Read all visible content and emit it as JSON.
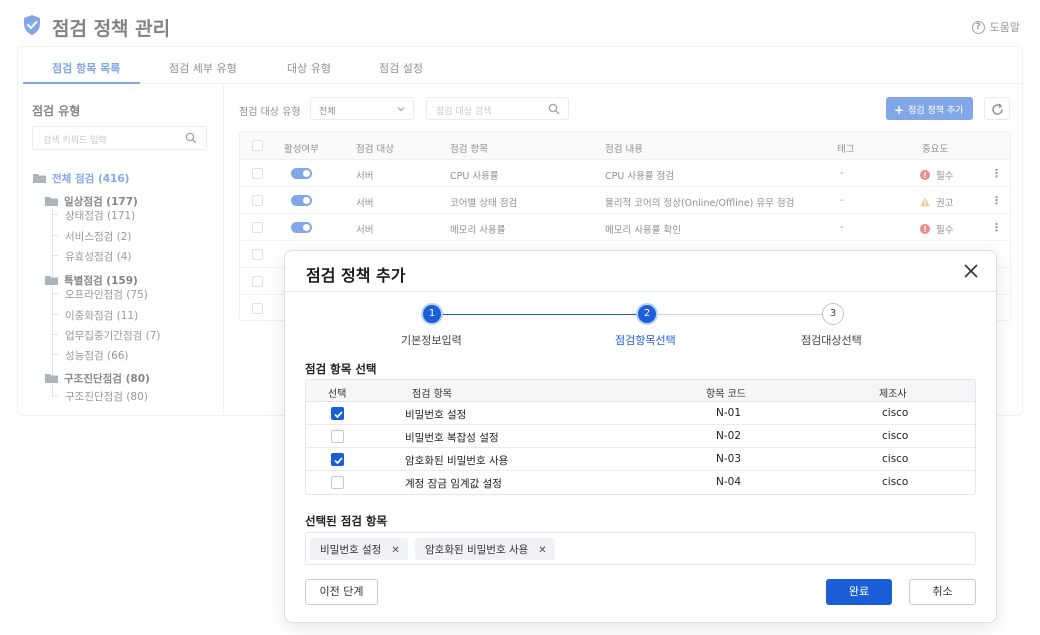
{
  "app": {
    "title": "점검 정책 관리",
    "help_label": "도움말"
  },
  "tabs": [
    {
      "label": "점검 항목 목록",
      "active": true
    },
    {
      "label": "점검 세부 유형",
      "active": false
    },
    {
      "label": "대상 유형",
      "active": false
    },
    {
      "label": "점검 설정",
      "active": false
    }
  ],
  "sidebar": {
    "title": "점검 유형",
    "search_placeholder": "검색 키워드 입력",
    "root": "전체 점검 (416)",
    "groups": [
      {
        "label": "일상점검 (177)",
        "children": [
          "상태점검 (171)",
          "서비스점검 (2)",
          "유효성점검 (4)"
        ]
      },
      {
        "label": "특별점검 (159)",
        "children": [
          "오프라인점검 (75)",
          "이중화점검 (11)",
          "업무집중기간점검 (7)",
          "성능점검 (66)"
        ]
      },
      {
        "label": "구조진단점검 (80)",
        "children": [
          "구조진단점검 (80)"
        ]
      }
    ]
  },
  "toolbar": {
    "filter_label": "점검 대상 유형",
    "filter_value": "전체",
    "search_placeholder": "점검 대상 검색",
    "add_button": "점검 정책 추가"
  },
  "table": {
    "columns": [
      "활성여부",
      "점검 대상",
      "점검 항목",
      "점검 내용",
      "태그",
      "중요도"
    ],
    "rows": [
      {
        "active": true,
        "target": "서버",
        "item": "CPU 사용률",
        "content": "CPU 사용률 점검",
        "tag": "-",
        "importance": "필수",
        "importance_type": "required"
      },
      {
        "active": true,
        "target": "서버",
        "item": "코어별 상태 점검",
        "content": "물리적 코어의 정상(Online/Offline) 유무 점검",
        "tag": "-",
        "importance": "권고",
        "importance_type": "recommended"
      },
      {
        "active": true,
        "target": "서버",
        "item": "메모리 사용률",
        "content": "메모리 사용률 확인",
        "tag": "-",
        "importance": "필수",
        "importance_type": "required"
      }
    ]
  },
  "modal": {
    "title": "점검 정책 추가",
    "steps": [
      {
        "number": "1",
        "label": "기본정보입력",
        "state": "done"
      },
      {
        "number": "2",
        "label": "점검항목선택",
        "state": "current"
      },
      {
        "number": "3",
        "label": "점검대상선택",
        "state": "todo"
      }
    ],
    "section_title": "점검 항목 선택",
    "columns": [
      "선택",
      "점검 항목",
      "항목 코드",
      "제조사"
    ],
    "rows": [
      {
        "checked": true,
        "item": "비밀번호 설정",
        "code": "N-01",
        "vendor": "cisco"
      },
      {
        "checked": false,
        "item": "비밀번호 복잡성 설정",
        "code": "N-02",
        "vendor": "cisco"
      },
      {
        "checked": true,
        "item": "암호화된 비밀번호 사용",
        "code": "N-03",
        "vendor": "cisco"
      },
      {
        "checked": false,
        "item": "계정 잠금 임계값 설정",
        "code": "N-04",
        "vendor": "cisco"
      }
    ],
    "selected_title": "선택된 점검 항목",
    "selected_chips": [
      "비밀번호 설정",
      "암호화된 비밀번호 사용"
    ],
    "prev_button": "이전 단계",
    "done_button": "완료",
    "cancel_button": "취소"
  },
  "colors": {
    "accent": "#1a5fd8",
    "required": "#d93025",
    "recommended": "#f29d38"
  }
}
